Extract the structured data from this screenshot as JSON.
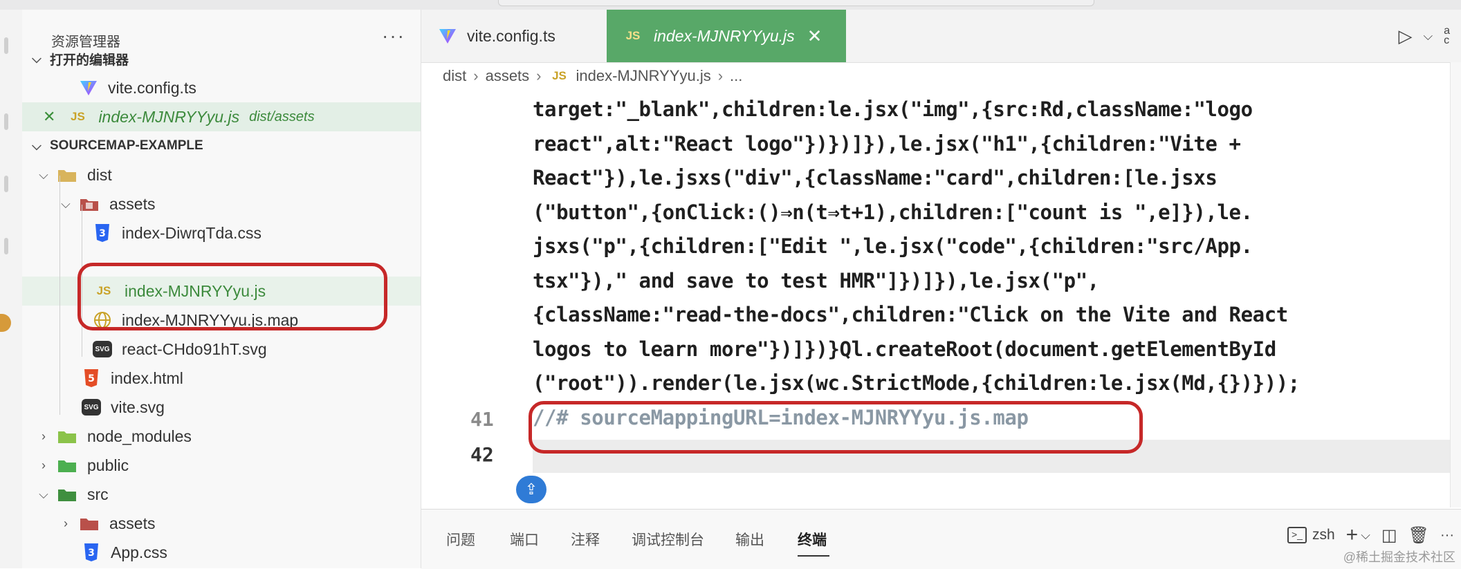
{
  "sidebar": {
    "title": "资源管理器",
    "more": "···",
    "open_editors_label": "打开的编辑器",
    "open_editors": [
      {
        "name": "vite.config.ts",
        "icon": "vite-icon"
      },
      {
        "name": "index-MJNRYYyu.js",
        "path": "dist/assets",
        "icon": "js-icon",
        "close": "✕"
      }
    ],
    "project_label": "SOURCEMAP-EXAMPLE",
    "tree": {
      "dist": "dist",
      "dist_assets": "assets",
      "css_file": "index-DiwrqTda.css",
      "js_file": "index-MJNRYYyu.js",
      "map_file": "index-MJNRYYyu.js.map",
      "svg_file": "react-CHdo91hT.svg",
      "index_html": "index.html",
      "vite_svg": "vite.svg",
      "node_modules": "node_modules",
      "public": "public",
      "src": "src",
      "src_assets": "assets",
      "app_css": "App.css"
    }
  },
  "tabs": [
    {
      "label": "vite.config.ts",
      "icon": "vite-icon"
    },
    {
      "label": "index-MJNRYYyu.js",
      "icon": "js-icon",
      "active": true,
      "close": "✕"
    }
  ],
  "icon_text": {
    "js": "JS",
    "css": "3",
    "html": "5",
    "svg": "SVG"
  },
  "breadcrumb": {
    "seg1": "dist",
    "seg2": "assets",
    "seg3": "index-MJNRYYyu.js",
    "seg4": "..."
  },
  "code_lines": [
    "target:\"_blank\",children:le.jsx(\"img\",{src:Rd,className:\"logo",
    "react\",alt:\"React logo\"})})]}),le.jsx(\"h1\",{children:\"Vite +",
    "React\"}),le.jsxs(\"div\",{className:\"card\",children:[le.jsxs",
    "(\"button\",{onClick:()⇒n(t⇒t+1),children:[\"count is \",e]}),le.",
    "jsxs(\"p\",{children:[\"Edit \",le.jsx(\"code\",{children:\"src/App.",
    "tsx\"}),\" and save to test HMR\"]})]}),le.jsx(\"p\",",
    "{className:\"read-the-docs\",children:\"Click on the Vite and React",
    "logos to learn more\"})]})}Ql.createRoot(document.getElementById",
    "(\"root\")).render(le.jsx(wc.StrictMode,{children:le.jsx(Md,{})}));",
    "//# sourceMappingURL=index-MJNRYYyu.js.map",
    ""
  ],
  "line_numbers": {
    "l41": "41",
    "l42": "42"
  },
  "panel": {
    "tabs": [
      "问题",
      "端口",
      "注释",
      "调试控制台",
      "输出",
      "终端"
    ],
    "terminal_label": "zsh",
    "terminal_icon_text": ">_"
  },
  "watermark": "@稀土掘金技术社区",
  "colors": {
    "active_tab": "#58a868",
    "annotation": "#c62828",
    "comment": "#8a98a4"
  }
}
